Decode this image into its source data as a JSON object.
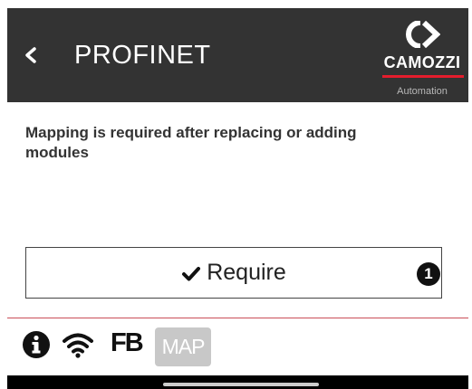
{
  "header": {
    "title": "PROFINET",
    "back_icon": "chevron-left-icon",
    "logo": {
      "brand": "CAMOZZI",
      "sub": "Automation",
      "accent": "#e41d2d"
    },
    "background": "#333333"
  },
  "message": "Mapping is required after replacing or adding modules",
  "require_button": {
    "icon": "check-icon",
    "label": "Require",
    "badge": "1"
  },
  "bottom_bar": {
    "info_icon": "info-icon",
    "wifi_icon": "wifi-icon",
    "fb_label": "FB",
    "map_label": "MAP"
  }
}
